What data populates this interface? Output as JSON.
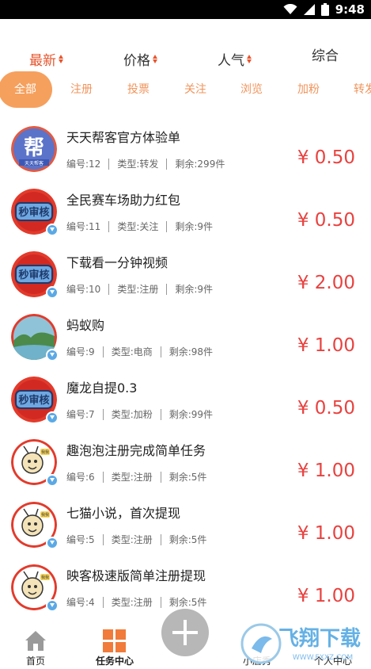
{
  "status_bar": {
    "time": "9:48"
  },
  "sort": [
    {
      "label": "最新",
      "active": true
    },
    {
      "label": "价格",
      "active": false
    },
    {
      "label": "人气",
      "active": false
    },
    {
      "label": "综合",
      "active": false
    }
  ],
  "tabs": [
    "全部",
    "注册",
    "投票",
    "关注",
    "浏览",
    "加粉",
    "转发"
  ],
  "tasks": [
    {
      "title": "天天帮客官方体验单",
      "id": "编号:12",
      "type": "类型:转发",
      "left": "剩余:299件",
      "price": "¥ 0.50",
      "avatar": "bang-logo"
    },
    {
      "title": "全民赛车场助力红包",
      "id": "编号:11",
      "type": "类型:关注",
      "left": "剩余:9件",
      "price": "¥ 0.50",
      "avatar": "miao-shen-he"
    },
    {
      "title": "下载看一分钟视频",
      "id": "编号:10",
      "type": "类型:注册",
      "left": "剩余:9件",
      "price": "¥ 2.00",
      "avatar": "miao-shen-he"
    },
    {
      "title": "蚂蚁购",
      "id": "编号:9",
      "type": "类型:电商",
      "left": "剩余:98件",
      "price": "¥ 1.00",
      "avatar": "landscape"
    },
    {
      "title": "魔龙自提0.3",
      "id": "编号:7",
      "type": "类型:加粉",
      "left": "剩余:99件",
      "price": "¥ 0.50",
      "avatar": "miao-shen-he"
    },
    {
      "title": "趣泡泡注册完成简单任务",
      "id": "编号:6",
      "type": "类型:注册",
      "left": "剩余:5件",
      "price": "¥ 1.00",
      "avatar": "cartoon-bee"
    },
    {
      "title": "七猫小说，首次提现",
      "id": "编号:5",
      "type": "类型:注册",
      "left": "剩余:5件",
      "price": "¥ 1.00",
      "avatar": "cartoon-bee"
    },
    {
      "title": "映客极速版简单注册提现",
      "id": "编号:4",
      "type": "类型:注册",
      "left": "剩余:5件",
      "price": "¥ 1.00",
      "avatar": "cartoon-bee"
    }
  ],
  "avatar_texts": {
    "bang": "帮",
    "bang_sub": "天天帮客",
    "miao": "秒审核",
    "bee_tag": "我我"
  },
  "bottom_nav": [
    {
      "label": "首页",
      "icon": "home-icon"
    },
    {
      "label": "任务中心",
      "icon": "grid-icon"
    },
    {
      "label": "小店秀",
      "icon": "shop-icon"
    },
    {
      "label": "个人中心",
      "icon": "user-icon"
    }
  ],
  "watermark": {
    "text": "飞翔下载",
    "url": "WWW.FXXZ.COM"
  },
  "colors": {
    "accent": "#e8542c",
    "tab_active": "#f6a05d",
    "price": "#e8423f"
  }
}
